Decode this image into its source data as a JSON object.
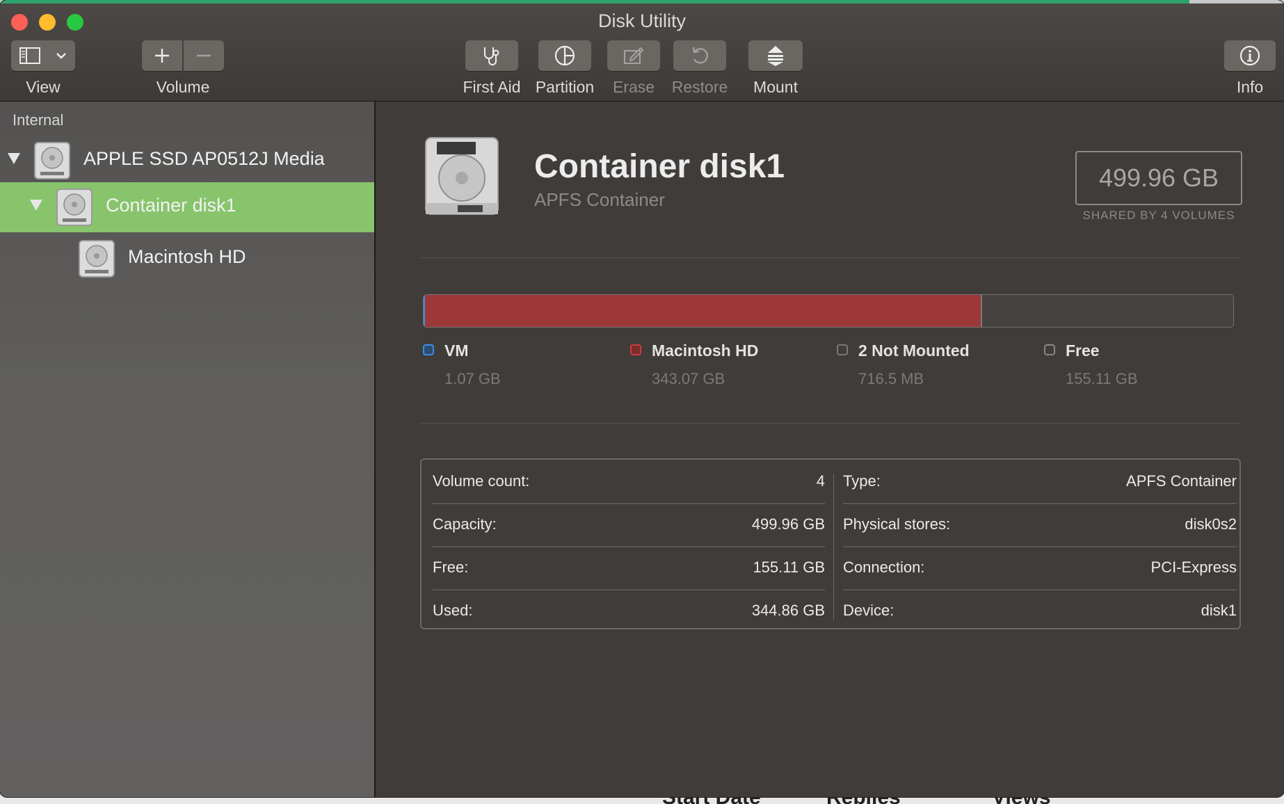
{
  "window": {
    "title": "Disk Utility"
  },
  "toolbar": {
    "view_label": "View",
    "volume_label": "Volume",
    "first_aid_label": "First Aid",
    "partition_label": "Partition",
    "erase_label": "Erase",
    "restore_label": "Restore",
    "mount_label": "Mount",
    "info_label": "Info"
  },
  "sidebar": {
    "section": "Internal",
    "items": [
      {
        "label": "APPLE SSD AP0512J Media",
        "expanded": true,
        "selected": false
      },
      {
        "label": "Container disk1",
        "expanded": true,
        "selected": true
      },
      {
        "label": "Macintosh HD",
        "selected": false
      }
    ]
  },
  "detail": {
    "title": "Container disk1",
    "subtitle": "APFS Container",
    "capacity": "499.96 GB",
    "capacity_caption": "SHARED BY 4 VOLUMES",
    "usage": [
      {
        "name": "VM",
        "size": "1.07 GB",
        "color": "#3a8ee6",
        "fraction": 0.002
      },
      {
        "name": "Macintosh HD",
        "size": "343.07 GB",
        "color": "#d0393a",
        "fraction": 0.686
      },
      {
        "name": "2 Not Mounted",
        "size": "716.5 MB",
        "color": "#7a7a7a",
        "fraction": 0.0014
      },
      {
        "name": "Free",
        "size": "155.11 GB",
        "color": "#45423f",
        "fraction": 0.31
      }
    ],
    "bar_fill_color": "#9d3838",
    "info_left": [
      {
        "label": "Volume count:",
        "value": "4"
      },
      {
        "label": "Capacity:",
        "value": "499.96 GB"
      },
      {
        "label": "Free:",
        "value": "155.11 GB"
      },
      {
        "label": "Used:",
        "value": "344.86 GB"
      }
    ],
    "info_right": [
      {
        "label": "Type:",
        "value": "APFS Container"
      },
      {
        "label": "Physical stores:",
        "value": "disk0s2"
      },
      {
        "label": "Connection:",
        "value": "PCI-Express"
      },
      {
        "label": "Device:",
        "value": "disk1"
      }
    ]
  },
  "background_text": [
    "Start Date",
    "Replies",
    "Views"
  ],
  "colors": {
    "selection": "#88c46c",
    "accent_green": "#2fa36b"
  }
}
